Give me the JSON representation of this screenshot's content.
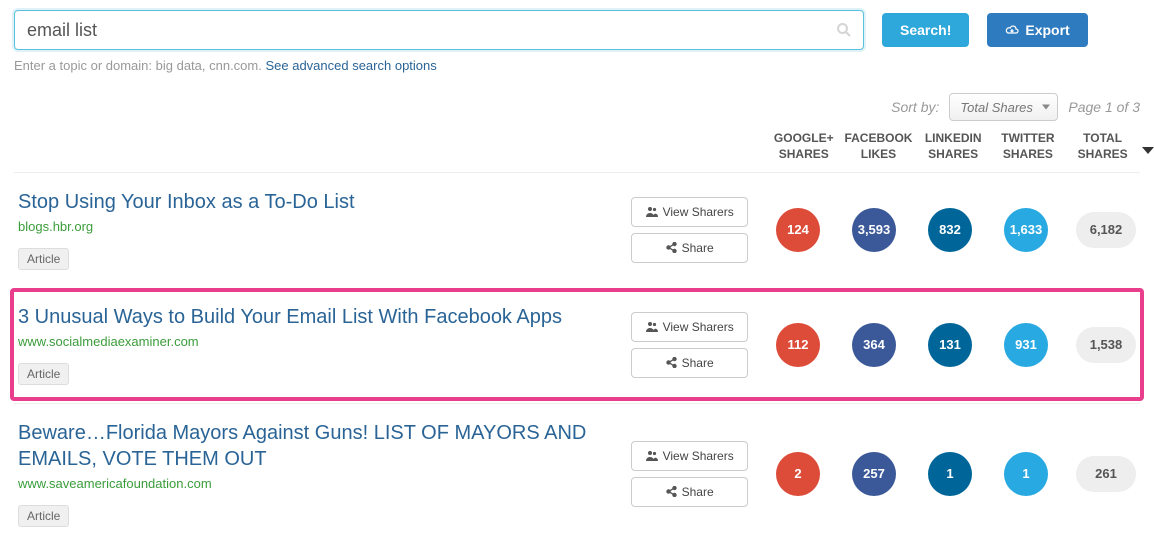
{
  "search": {
    "value": "email list",
    "placeholder": ""
  },
  "buttons": {
    "search": "Search!",
    "export": "Export"
  },
  "hint": {
    "prefix": "Enter a topic or domain: big data, cnn.com. ",
    "link": "See advanced search options"
  },
  "sort": {
    "label": "Sort by:",
    "selected": "Total Shares",
    "page": "Page 1 of 3"
  },
  "headers": {
    "google": "GOOGLE+ SHARES",
    "facebook": "FACEBOOK LIKES",
    "linkedin": "LINKEDIN SHARES",
    "twitter": "TWITTER SHARES",
    "total": "TOTAL SHARES"
  },
  "actions": {
    "viewSharers": "View Sharers",
    "share": "Share"
  },
  "tag": "Article",
  "rows": [
    {
      "title": "Stop Using Your Inbox as a To-Do List",
      "domain": "blogs.hbr.org",
      "google": "124",
      "facebook": "3,593",
      "linkedin": "832",
      "twitter": "1,633",
      "total": "6,182",
      "highlighted": false
    },
    {
      "title": "3 Unusual Ways to Build Your Email List With Facebook Apps",
      "domain": "www.socialmediaexaminer.com",
      "google": "112",
      "facebook": "364",
      "linkedin": "131",
      "twitter": "931",
      "total": "1,538",
      "highlighted": true
    },
    {
      "title": "Beware…Florida Mayors Against Guns! LIST OF MAYORS AND EMAILS, VOTE THEM OUT",
      "domain": "www.saveamericafoundation.com",
      "google": "2",
      "facebook": "257",
      "linkedin": "1",
      "twitter": "1",
      "total": "261",
      "highlighted": false
    }
  ]
}
